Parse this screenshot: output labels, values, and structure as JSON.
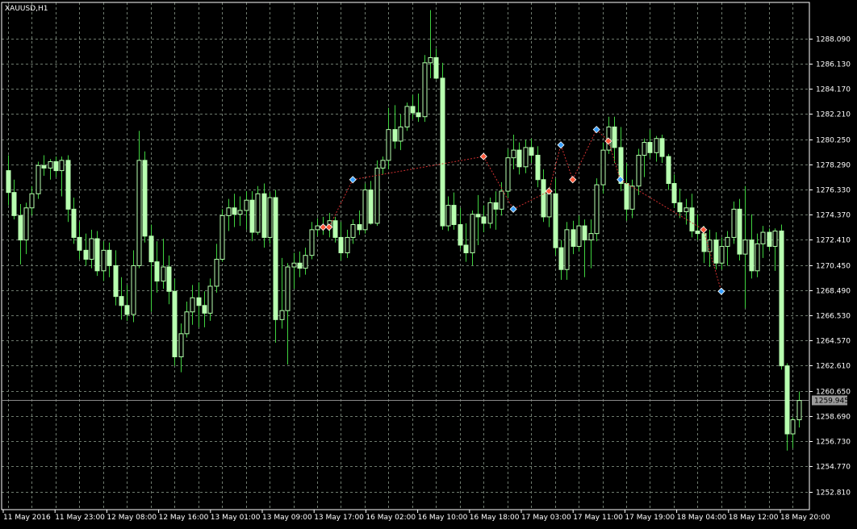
{
  "window": {
    "title": "XAUUSD,H1",
    "current_price": "1259.945"
  },
  "colors": {
    "background": "#000000",
    "grid": "#6e7a6e",
    "frame": "#ffffff",
    "candle": "#b8ffb0",
    "wick": "#3fd23f",
    "price_line": "#8a8a8a",
    "buy_marker": "#3aa0ff",
    "sell_marker": "#ff5a3c",
    "trade_line": "#d03030"
  },
  "chart_data": {
    "type": "candlestick",
    "symbol": "XAUUSD",
    "timeframe": "H1",
    "y_ticks": [
      "1288.090",
      "1286.130",
      "1284.170",
      "1282.210",
      "1280.250",
      "1278.290",
      "1276.330",
      "1274.370",
      "1272.410",
      "1270.450",
      "1268.490",
      "1266.530",
      "1264.570",
      "1262.610",
      "1260.650",
      "1258.690",
      "1256.730",
      "1254.770",
      "1252.810"
    ],
    "ylim": [
      1251.4,
      1290.9
    ],
    "x_labels": [
      "11 May 2016",
      "11 May 23:00",
      "12 May 08:00",
      "12 May 16:00",
      "13 May 01:00",
      "13 May 09:00",
      "13 May 17:00",
      "16 May 02:00",
      "16 May 10:00",
      "16 May 18:00",
      "17 May 03:00",
      "17 May 11:00",
      "17 May 19:00",
      "18 May 04:00",
      "18 May 12:00",
      "18 May 20:00"
    ],
    "grid": true,
    "current_price": 1259.945,
    "candles": [
      [
        1277.8,
        1279.0,
        1275.1,
        1276.1
      ],
      [
        1276.1,
        1277.1,
        1274.0,
        1274.3
      ],
      [
        1274.3,
        1275.2,
        1270.5,
        1272.4
      ],
      [
        1272.4,
        1275.3,
        1271.3,
        1274.9
      ],
      [
        1274.9,
        1276.6,
        1274.3,
        1276.0
      ],
      [
        1276.0,
        1278.5,
        1275.6,
        1278.2
      ],
      [
        1278.2,
        1279.0,
        1277.4,
        1278.0
      ],
      [
        1278.0,
        1278.7,
        1277.1,
        1278.5
      ],
      [
        1278.5,
        1278.9,
        1277.3,
        1277.8
      ],
      [
        1277.8,
        1278.9,
        1275.8,
        1278.6
      ],
      [
        1278.6,
        1279.0,
        1273.8,
        1274.8
      ],
      [
        1274.8,
        1275.7,
        1272.1,
        1272.6
      ],
      [
        1272.6,
        1273.8,
        1270.9,
        1271.6
      ],
      [
        1271.6,
        1272.9,
        1270.4,
        1270.9
      ],
      [
        1270.9,
        1273.2,
        1270.2,
        1272.5
      ],
      [
        1272.5,
        1273.1,
        1269.6,
        1270.0
      ],
      [
        1270.0,
        1272.3,
        1269.2,
        1271.6
      ],
      [
        1271.6,
        1272.2,
        1269.5,
        1270.4
      ],
      [
        1270.4,
        1271.6,
        1267.3,
        1268.0
      ],
      [
        1268.0,
        1269.5,
        1266.2,
        1267.3
      ],
      [
        1267.3,
        1268.9,
        1266.1,
        1266.6
      ],
      [
        1266.6,
        1271.6,
        1266.0,
        1270.4
      ],
      [
        1270.4,
        1280.9,
        1270.2,
        1278.6
      ],
      [
        1278.6,
        1279.3,
        1272.2,
        1272.7
      ],
      [
        1272.7,
        1273.6,
        1266.8,
        1270.7
      ],
      [
        1270.7,
        1272.3,
        1268.3,
        1269.2
      ],
      [
        1269.2,
        1272.5,
        1268.6,
        1270.3
      ],
      [
        1270.3,
        1271.2,
        1267.4,
        1268.4
      ],
      [
        1268.4,
        1269.4,
        1262.6,
        1263.3
      ],
      [
        1263.3,
        1265.9,
        1262.1,
        1265.1
      ],
      [
        1265.1,
        1267.6,
        1264.8,
        1266.8
      ],
      [
        1266.8,
        1268.9,
        1265.8,
        1267.9
      ],
      [
        1267.9,
        1269.1,
        1265.6,
        1267.3
      ],
      [
        1267.3,
        1268.4,
        1265.6,
        1266.7
      ],
      [
        1266.7,
        1269.4,
        1266.1,
        1268.8
      ],
      [
        1268.8,
        1272.1,
        1268.3,
        1270.9
      ],
      [
        1270.9,
        1274.8,
        1270.7,
        1274.3
      ],
      [
        1274.3,
        1275.6,
        1273.1,
        1274.9
      ],
      [
        1274.9,
        1276.0,
        1273.4,
        1274.4
      ],
      [
        1274.4,
        1275.8,
        1273.5,
        1274.7
      ],
      [
        1274.7,
        1276.2,
        1273.2,
        1275.5
      ],
      [
        1275.5,
        1276.2,
        1272.3,
        1273.0
      ],
      [
        1273.0,
        1276.6,
        1272.8,
        1276.0
      ],
      [
        1276.0,
        1276.8,
        1271.8,
        1272.6
      ],
      [
        1272.6,
        1276.1,
        1272.1,
        1275.7
      ],
      [
        1275.7,
        1276.3,
        1264.4,
        1266.2
      ],
      [
        1266.2,
        1271.0,
        1265.5,
        1266.9
      ],
      [
        1266.9,
        1270.6,
        1262.7,
        1270.3
      ],
      [
        1270.3,
        1271.4,
        1268.6,
        1270.6
      ],
      [
        1270.6,
        1271.5,
        1269.5,
        1270.2
      ],
      [
        1270.2,
        1271.8,
        1269.7,
        1271.2
      ],
      [
        1271.2,
        1273.8,
        1270.9,
        1273.2
      ],
      [
        1273.2,
        1274.1,
        1272.7,
        1273.5
      ],
      [
        1273.5,
        1274.2,
        1272.8,
        1273.4
      ],
      [
        1273.4,
        1274.5,
        1272.6,
        1273.9
      ],
      [
        1273.9,
        1274.2,
        1272.2,
        1272.6
      ],
      [
        1272.6,
        1273.8,
        1270.8,
        1271.4
      ],
      [
        1271.4,
        1273.2,
        1271.0,
        1272.6
      ],
      [
        1272.6,
        1274.0,
        1272.1,
        1273.6
      ],
      [
        1273.6,
        1274.7,
        1272.8,
        1273.2
      ],
      [
        1273.2,
        1276.8,
        1272.9,
        1276.3
      ],
      [
        1276.3,
        1277.0,
        1273.6,
        1273.7
      ],
      [
        1273.7,
        1278.6,
        1273.5,
        1278.0
      ],
      [
        1278.0,
        1278.9,
        1277.5,
        1278.6
      ],
      [
        1278.6,
        1282.7,
        1277.9,
        1281.0
      ],
      [
        1281.0,
        1282.9,
        1279.5,
        1280.1
      ],
      [
        1280.1,
        1282.2,
        1279.4,
        1281.2
      ],
      [
        1281.2,
        1283.1,
        1280.9,
        1282.8
      ],
      [
        1282.8,
        1283.7,
        1281.8,
        1282.3
      ],
      [
        1282.3,
        1283.8,
        1281.6,
        1282.0
      ],
      [
        1282.0,
        1286.8,
        1281.6,
        1286.2
      ],
      [
        1286.2,
        1290.3,
        1285.0,
        1286.6
      ],
      [
        1286.6,
        1287.3,
        1284.9,
        1285.0
      ],
      [
        1285.0,
        1286.2,
        1273.2,
        1273.5
      ],
      [
        1273.5,
        1275.8,
        1273.1,
        1275.1
      ],
      [
        1275.1,
        1276.1,
        1273.2,
        1273.6
      ],
      [
        1273.6,
        1274.9,
        1271.7,
        1272.0
      ],
      [
        1272.0,
        1273.7,
        1270.7,
        1271.4
      ],
      [
        1271.4,
        1274.7,
        1270.4,
        1274.4
      ],
      [
        1274.4,
        1275.9,
        1272.0,
        1274.2
      ],
      [
        1274.2,
        1275.1,
        1273.0,
        1273.7
      ],
      [
        1273.7,
        1275.7,
        1273.3,
        1275.3
      ],
      [
        1275.3,
        1276.2,
        1273.2,
        1274.8
      ],
      [
        1274.8,
        1276.9,
        1274.3,
        1276.2
      ],
      [
        1276.2,
        1279.5,
        1275.7,
        1278.8
      ],
      [
        1278.8,
        1280.6,
        1277.9,
        1279.4
      ],
      [
        1279.4,
        1280.0,
        1277.5,
        1278.1
      ],
      [
        1278.1,
        1280.2,
        1277.6,
        1279.6
      ],
      [
        1279.6,
        1280.3,
        1278.4,
        1279.0
      ],
      [
        1279.0,
        1279.7,
        1276.5,
        1277.1
      ],
      [
        1277.1,
        1277.9,
        1273.8,
        1274.2
      ],
      [
        1274.2,
        1276.5,
        1273.4,
        1276.0
      ],
      [
        1276.0,
        1277.2,
        1271.2,
        1271.8
      ],
      [
        1271.8,
        1272.4,
        1269.3,
        1270.1
      ],
      [
        1270.1,
        1273.8,
        1269.3,
        1273.2
      ],
      [
        1273.2,
        1273.9,
        1271.3,
        1271.9
      ],
      [
        1271.9,
        1274.3,
        1271.5,
        1273.5
      ],
      [
        1273.5,
        1274.0,
        1269.5,
        1272.4
      ],
      [
        1272.4,
        1274.0,
        1270.2,
        1272.9
      ],
      [
        1272.9,
        1277.2,
        1272.3,
        1276.7
      ],
      [
        1276.7,
        1280.0,
        1276.0,
        1279.4
      ],
      [
        1279.4,
        1282.0,
        1279.1,
        1281.2
      ],
      [
        1281.2,
        1282.0,
        1278.4,
        1279.6
      ],
      [
        1279.6,
        1281.2,
        1276.2,
        1276.8
      ],
      [
        1276.8,
        1278.4,
        1273.9,
        1274.8
      ],
      [
        1274.8,
        1277.1,
        1274.1,
        1276.6
      ],
      [
        1276.6,
        1279.5,
        1275.9,
        1279.0
      ],
      [
        1279.0,
        1280.3,
        1277.3,
        1280.0
      ],
      [
        1280.0,
        1281.0,
        1278.8,
        1279.2
      ],
      [
        1279.2,
        1280.5,
        1278.5,
        1280.3
      ],
      [
        1280.3,
        1280.6,
        1278.4,
        1278.9
      ],
      [
        1278.9,
        1279.1,
        1276.3,
        1276.8
      ],
      [
        1276.8,
        1277.5,
        1274.9,
        1275.3
      ],
      [
        1275.3,
        1276.4,
        1274.1,
        1274.6
      ],
      [
        1274.6,
        1275.6,
        1273.6,
        1274.9
      ],
      [
        1274.9,
        1276.0,
        1272.6,
        1273.1
      ],
      [
        1273.1,
        1274.4,
        1272.4,
        1272.9
      ],
      [
        1272.9,
        1273.5,
        1270.6,
        1271.5
      ],
      [
        1271.5,
        1273.2,
        1270.3,
        1272.4
      ],
      [
        1272.4,
        1273.0,
        1270.1,
        1270.6
      ],
      [
        1270.6,
        1272.6,
        1270.1,
        1271.9
      ],
      [
        1271.9,
        1273.1,
        1270.4,
        1272.6
      ],
      [
        1272.6,
        1275.4,
        1272.1,
        1274.8
      ],
      [
        1274.8,
        1275.6,
        1270.8,
        1271.3
      ],
      [
        1271.3,
        1276.6,
        1267.1,
        1272.4
      ],
      [
        1272.4,
        1274.4,
        1269.4,
        1270.0
      ],
      [
        1270.0,
        1272.9,
        1269.5,
        1272.1
      ],
      [
        1272.1,
        1273.5,
        1271.0,
        1273.0
      ],
      [
        1273.0,
        1273.3,
        1271.6,
        1271.9
      ],
      [
        1271.9,
        1273.3,
        1270.0,
        1273.1
      ],
      [
        1273.1,
        1273.6,
        1262.3,
        1262.6
      ],
      [
        1262.6,
        1262.8,
        1256.0,
        1257.3
      ],
      [
        1257.3,
        1258.6,
        1256.2,
        1258.4
      ],
      [
        1258.4,
        1260.6,
        1257.8,
        1259.9
      ]
    ],
    "trades": [
      {
        "type": "sell",
        "index": 53,
        "price": 1273.4
      },
      {
        "type": "sell",
        "index": 54,
        "price": 1273.4
      },
      {
        "type": "buy",
        "index": 58,
        "price": 1277.1
      },
      {
        "type": "sell",
        "index": 80,
        "price": 1278.9
      },
      {
        "type": "buy",
        "index": 85,
        "price": 1274.8
      },
      {
        "type": "sell",
        "index": 91,
        "price": 1276.2
      },
      {
        "type": "buy",
        "index": 93,
        "price": 1279.8
      },
      {
        "type": "sell",
        "index": 95,
        "price": 1277.1
      },
      {
        "type": "buy",
        "index": 99,
        "price": 1281.0
      },
      {
        "type": "sell",
        "index": 101,
        "price": 1280.1
      },
      {
        "type": "buy",
        "index": 103,
        "price": 1277.1
      },
      {
        "type": "sell",
        "index": 117,
        "price": 1273.2
      },
      {
        "type": "buy",
        "index": 120,
        "price": 1268.4
      }
    ]
  }
}
